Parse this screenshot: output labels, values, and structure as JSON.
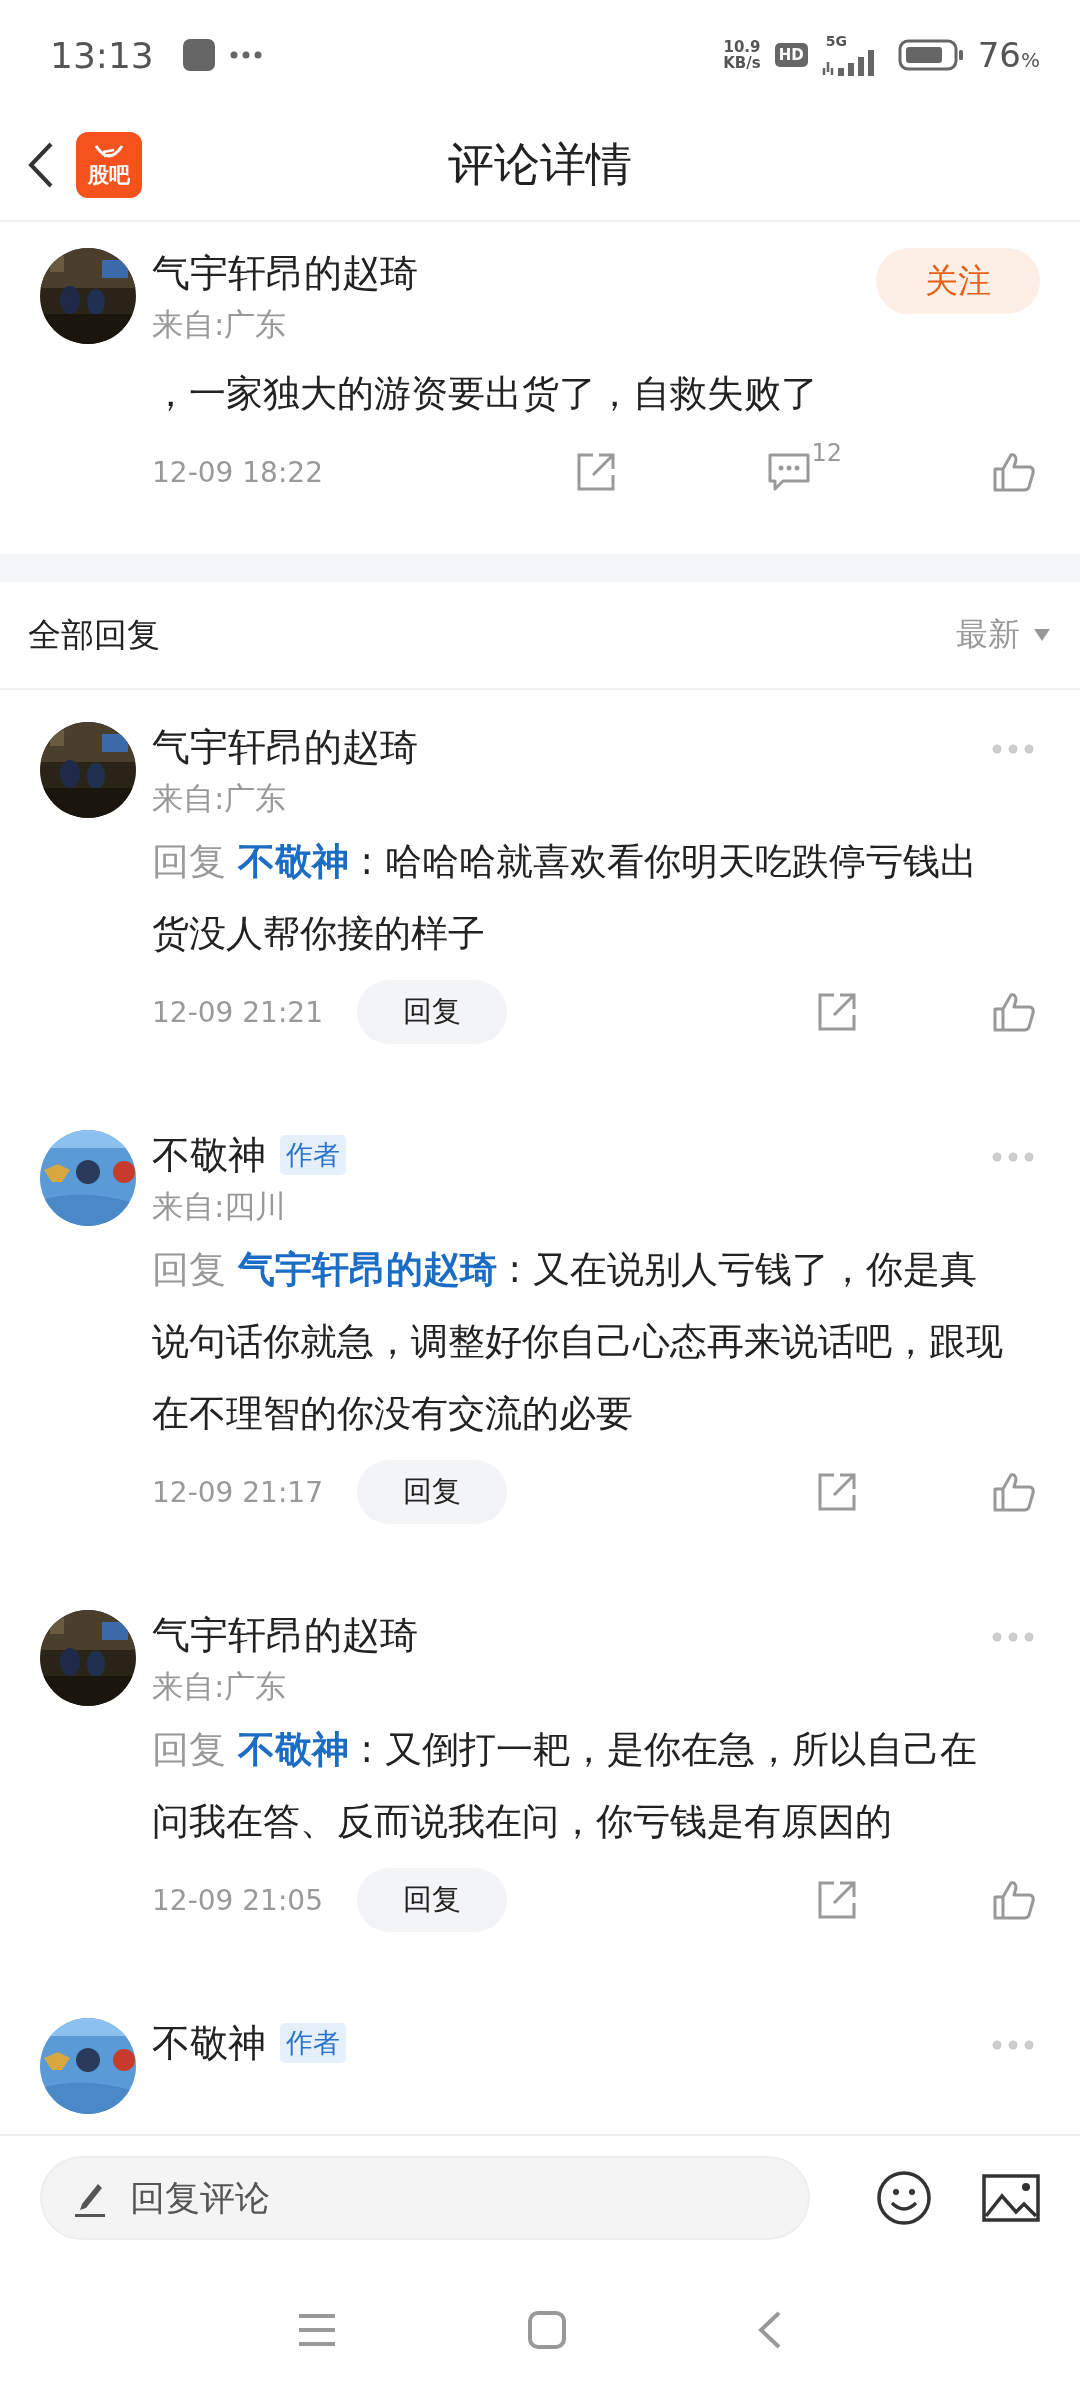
{
  "status_bar": {
    "time": "13:13",
    "net_speed": "10.9",
    "net_unit": "KB/s",
    "hd": "HD",
    "network": "5G",
    "battery": "76",
    "battery_unit": "%"
  },
  "header": {
    "logo_text": "股吧",
    "title": "评论详情"
  },
  "post": {
    "author": "气宇轩昂的赵琦",
    "location": "来自:广东",
    "follow_button": "关注",
    "text": "，一家独大的游资要出货了，自救失败了",
    "time": "12-09 18:22",
    "comment_count": "12"
  },
  "replies_header": {
    "title": "全部回复",
    "sort": "最新"
  },
  "replies": [
    {
      "author": "气宇轩昂的赵琦",
      "location": "来自:广东",
      "reply_label": "回复",
      "reply_to": "不敬神",
      "text": ": 哈哈哈就喜欢看你明天吃跌停亏钱出货没人帮你接的样子",
      "time": "12-09 21:21",
      "reply_button": "回复"
    },
    {
      "author": "不敬神",
      "badge": "作者",
      "location": "来自:四川",
      "reply_label": "回复",
      "reply_to": "气宇轩昂的赵琦",
      "text": ": 又在说别人亏钱了，你是真说句话你就急，调整好你自己心态再来说话吧，跟现在不理智的你没有交流的必要",
      "time": "12-09 21:17",
      "reply_button": "回复"
    },
    {
      "author": "气宇轩昂的赵琦",
      "location": "来自:广东",
      "reply_label": "回复",
      "reply_to": "不敬神",
      "text": ": 又倒打一耙，是你在急，所以自己在问我在答、反而说我在问，你亏钱是有原因的",
      "time": "12-09 21:05",
      "reply_button": "回复"
    },
    {
      "author": "不敬神",
      "badge": "作者"
    }
  ],
  "reply_bar": {
    "placeholder": "回复评论"
  }
}
